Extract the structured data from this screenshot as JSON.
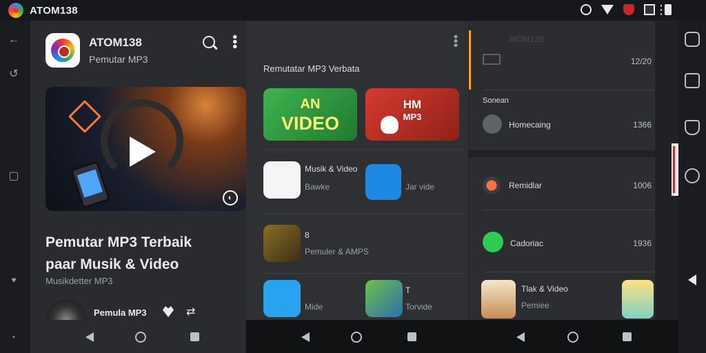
{
  "status_bar": {
    "app_name": "ATOM138"
  },
  "panel1": {
    "app_title": "ATOM138",
    "app_subtitle": "Pemutar MP3",
    "headline_line1": "Pemutar MP3 Terbaik",
    "headline_line2": "paar Musik & Video",
    "caption": "Musikdetter MP3",
    "track_title": "Pemula MP3"
  },
  "panel2": {
    "section_title": "Remutatar MP3 Verbata",
    "tile_green": {
      "line1": "AN",
      "line2": "VIDEO"
    },
    "tile_red": {
      "line1": "HM",
      "line2": "MP3"
    },
    "rows": [
      {
        "title": "Musik & Video",
        "sub": "Bawke",
        "right_sub": "Jar vide"
      },
      {
        "title": "8",
        "sub": "Pemuler & AMPS"
      },
      {
        "title": "Mide",
        "right_title": "T",
        "right_sub": "Torvide"
      }
    ]
  },
  "panel3": {
    "ghost_title": "AtOM138",
    "top_value": "12/20",
    "section_label": "Sonean",
    "rows": [
      {
        "label": "Homecaing",
        "value": "1366"
      },
      {
        "label": "Remidlar",
        "value": "1006"
      },
      {
        "label": "Cadoriac",
        "value": "1936"
      },
      {
        "label": "Tlak & Video",
        "sub": "Pemiee"
      }
    ]
  },
  "colors": {
    "accent_yellow": "#f9a825",
    "tile_green": "#3fb34f",
    "tile_red": "#d63b2f"
  }
}
